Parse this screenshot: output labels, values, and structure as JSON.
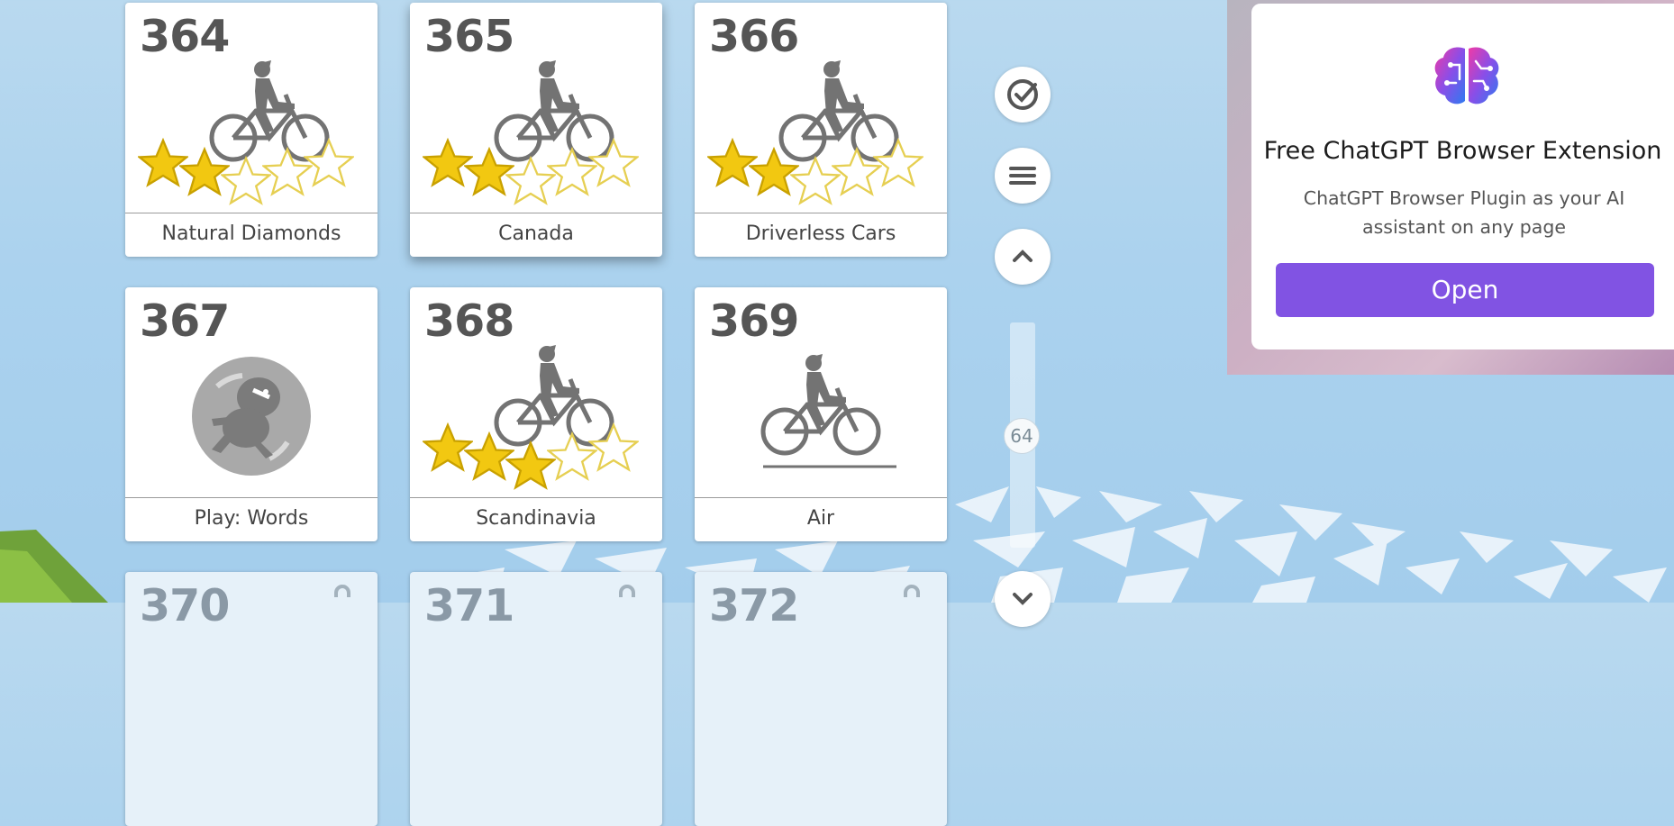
{
  "cards": [
    {
      "number": "364",
      "label": "Natural Diamonds",
      "stars_earned": 2,
      "stars_total": 5,
      "icon": "cyclist-icon"
    },
    {
      "number": "365",
      "label": "Canada",
      "stars_earned": 2,
      "stars_total": 5,
      "icon": "cyclist-icon"
    },
    {
      "number": "366",
      "label": "Driverless Cars",
      "stars_earned": 2,
      "stars_total": 5,
      "icon": "cyclist-icon"
    },
    {
      "number": "367",
      "label": "Play: Words",
      "icon": "game-badge-icon"
    },
    {
      "number": "368",
      "label": "Scandinavia",
      "stars_earned": 3,
      "stars_total": 5,
      "icon": "cyclist-icon"
    },
    {
      "number": "369",
      "label": "Air",
      "icon": "cyclist-icon"
    },
    {
      "number": "370",
      "icon": "lock-icon"
    },
    {
      "number": "371",
      "icon": "lock-icon"
    },
    {
      "number": "372",
      "icon": "lock-icon"
    }
  ],
  "side_controls": {
    "check_icon": "check-circle-icon",
    "menu_icon": "menu-icon",
    "up_icon": "chevron-up-icon",
    "down_icon": "chevron-down-icon",
    "scroll_position": "64"
  },
  "ad": {
    "logo_icon": "brain-icon",
    "title": "Free ChatGPT Browser Extension",
    "description": "ChatGPT Browser Plugin as your AI assistant on any page",
    "button_label": "Open",
    "accent_color": "#8153e3"
  },
  "colors": {
    "star_filled": "#f2c811",
    "star_empty": "#ffffff",
    "background_sky": "#abd2ee"
  }
}
